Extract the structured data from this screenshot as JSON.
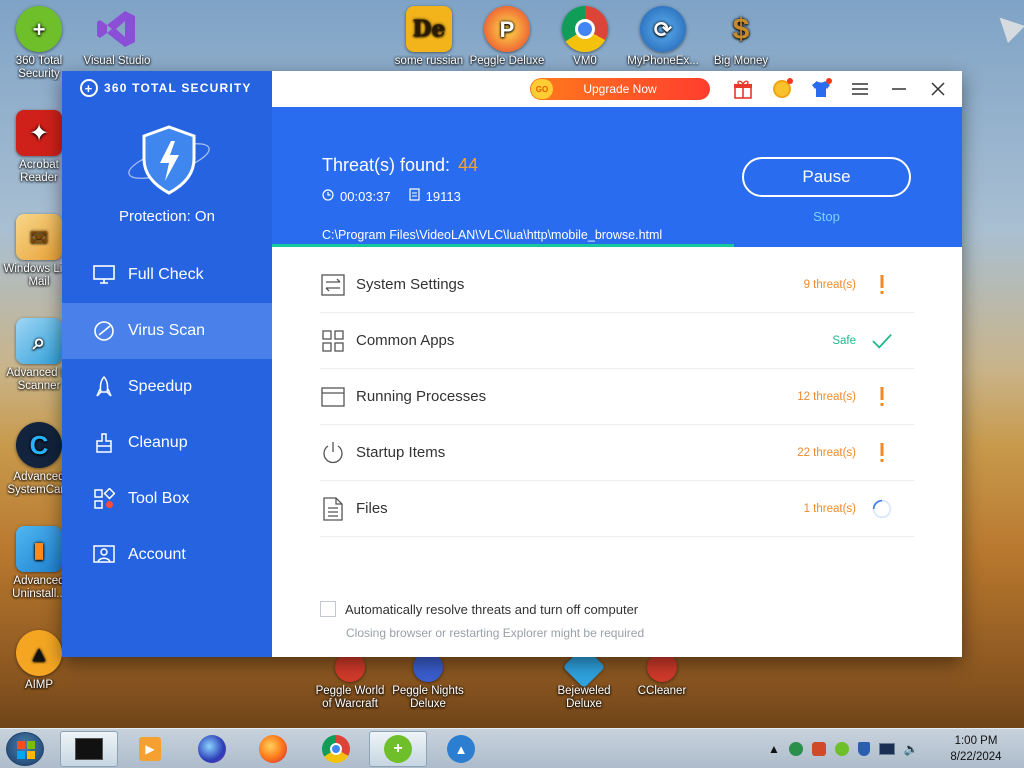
{
  "desktop": {
    "icons": [
      {
        "label": "360 Total Security",
        "icon": "360-security-icon",
        "color": "#6fbf2b"
      },
      {
        "label": "Visual Studio",
        "icon": "visual-studio-icon",
        "color": "#7a3cc5"
      },
      {
        "label": "some russian",
        "icon": "de-app-icon",
        "color": "#f3b41b"
      },
      {
        "label": "Peggle Deluxe",
        "icon": "peggle-icon",
        "color": "#e8392b"
      },
      {
        "label": "VM0",
        "icon": "chrome-icon",
        "color": "#4285f4"
      },
      {
        "label": "MyPhoneEx...",
        "icon": "myphoneexplorer-icon",
        "color": "#2a7fd4"
      },
      {
        "label": "Big Money",
        "icon": "money-bag-icon",
        "color": "#c98a2b"
      },
      {
        "label": "Acrobat Reader",
        "icon": "acrobat-icon",
        "color": "#d0201a"
      },
      {
        "label": "Windows Live Mail",
        "icon": "mail-icon",
        "color": "#e8a036"
      },
      {
        "label": "Advanced IP Scanner",
        "icon": "ip-scanner-icon",
        "color": "#2f9fd8"
      },
      {
        "label": "Advanced SystemCare",
        "icon": "systemcare-icon",
        "color": "#1b8fe0"
      },
      {
        "label": "Advanced Uninstall...",
        "icon": "uninstaller-icon",
        "color": "#1e7fd0"
      },
      {
        "label": "AIMP",
        "icon": "aimp-icon",
        "color": "#f4a623"
      },
      {
        "label": "Peggle World of Warcraft",
        "icon": "peggle-wow-icon",
        "color": "#d33a2a"
      },
      {
        "label": "Peggle Nights Deluxe",
        "icon": "peggle-nights-icon",
        "color": "#3a5fd0"
      },
      {
        "label": "Bejeweled Deluxe",
        "icon": "bejeweled-icon",
        "color": "#2fa3e0"
      },
      {
        "label": "CCleaner",
        "icon": "ccleaner-icon",
        "color": "#d03a2a"
      }
    ]
  },
  "app": {
    "brand": "360 TOTAL SECURITY",
    "protection_status": "Protection: On",
    "nav": [
      {
        "label": "Full Check",
        "icon": "monitor-icon"
      },
      {
        "label": "Virus Scan",
        "icon": "virus-scan-icon",
        "active": true
      },
      {
        "label": "Speedup",
        "icon": "rocket-icon"
      },
      {
        "label": "Cleanup",
        "icon": "broom-icon"
      },
      {
        "label": "Tool Box",
        "icon": "toolbox-icon"
      },
      {
        "label": "Account",
        "icon": "account-icon"
      }
    ],
    "topbar": {
      "upgrade_label": "Upgrade Now",
      "go_badge": "GO",
      "icons": [
        "gift-icon",
        "coin-icon",
        "shirt-icon",
        "menu-icon",
        "minimize-icon",
        "close-icon"
      ]
    },
    "scan": {
      "threats_label": "Threat(s) found:",
      "threats_count": "44",
      "elapsed": "00:03:37",
      "files_scanned": "19113",
      "current_path": "C:\\Program Files\\VideoLAN\\VLC\\lua\\http\\mobile_browse.html",
      "progress": 0.67,
      "pause_label": "Pause",
      "stop_label": "Stop"
    },
    "results": [
      {
        "label": "System Settings",
        "status": "9 threat(s)",
        "state": "threat",
        "icon": "settings-sliders-icon"
      },
      {
        "label": "Common Apps",
        "status": "Safe",
        "state": "safe",
        "icon": "apps-grid-icon"
      },
      {
        "label": "Running Processes",
        "status": "12 threat(s)",
        "state": "threat",
        "icon": "window-icon"
      },
      {
        "label": "Startup Items",
        "status": "22 threat(s)",
        "state": "threat",
        "icon": "power-icon"
      },
      {
        "label": "Files",
        "status": "1 threat(s)",
        "state": "scanning",
        "icon": "file-icon"
      }
    ],
    "auto_resolve": {
      "label": "Automatically resolve threats and turn off computer",
      "note": "Closing browser or restarting Explorer might be required",
      "checked": false
    }
  },
  "taskbar": {
    "time": "1:00 PM",
    "date": "8/22/2024"
  },
  "colors": {
    "brand_blue": "#2563e0",
    "header_blue": "#2a6cf0",
    "threat_orange": "#f08a2a",
    "safe_green": "#1fb88a",
    "count_orange": "#f5a524"
  }
}
